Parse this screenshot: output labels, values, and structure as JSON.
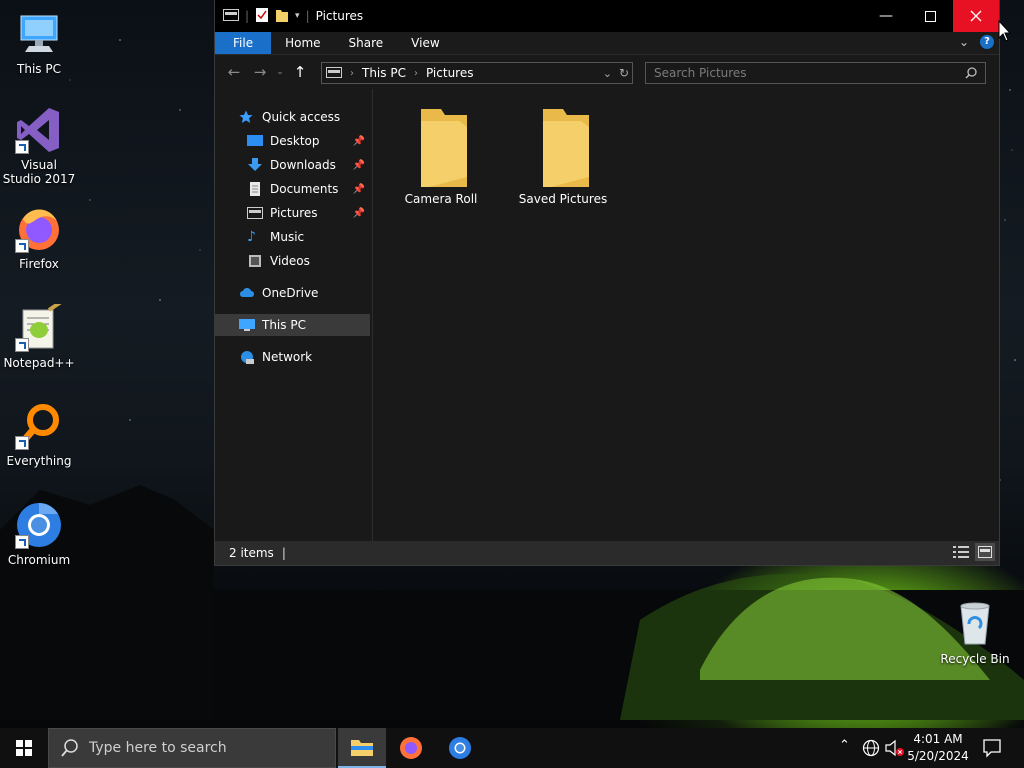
{
  "desktop": {
    "icons": [
      {
        "label": "This PC",
        "icon": "this-pc-icon"
      },
      {
        "label": "Visual Studio 2017",
        "icon": "visual-studio-icon"
      },
      {
        "label": "Firefox",
        "icon": "firefox-icon"
      },
      {
        "label": "Notepad++",
        "icon": "notepad-plus-plus-icon"
      },
      {
        "label": "Everything",
        "icon": "everything-search-icon"
      },
      {
        "label": "Chromium",
        "icon": "chromium-icon"
      },
      {
        "label": "Recycle Bin",
        "icon": "recycle-bin-icon"
      }
    ]
  },
  "explorer": {
    "title": "Pictures",
    "ribbon_tabs": [
      "File",
      "Home",
      "Share",
      "View"
    ],
    "breadcrumb": [
      "This PC",
      "Pictures"
    ],
    "search_placeholder": "Search Pictures",
    "nav": {
      "quick_access": "Quick access",
      "quick_items": [
        "Desktop",
        "Downloads",
        "Documents",
        "Pictures",
        "Music",
        "Videos"
      ],
      "onedrive": "OneDrive",
      "this_pc": "This PC",
      "network": "Network"
    },
    "items": [
      "Camera Roll",
      "Saved Pictures"
    ],
    "status": "2 items"
  },
  "taskbar": {
    "search_placeholder": "Type here to search",
    "time": "4:01 AM",
    "date": "5/20/2024"
  },
  "colors": {
    "accent": "#1a6fc9",
    "close_red": "#e81123",
    "folder_yellow": "#f5cf6a"
  }
}
